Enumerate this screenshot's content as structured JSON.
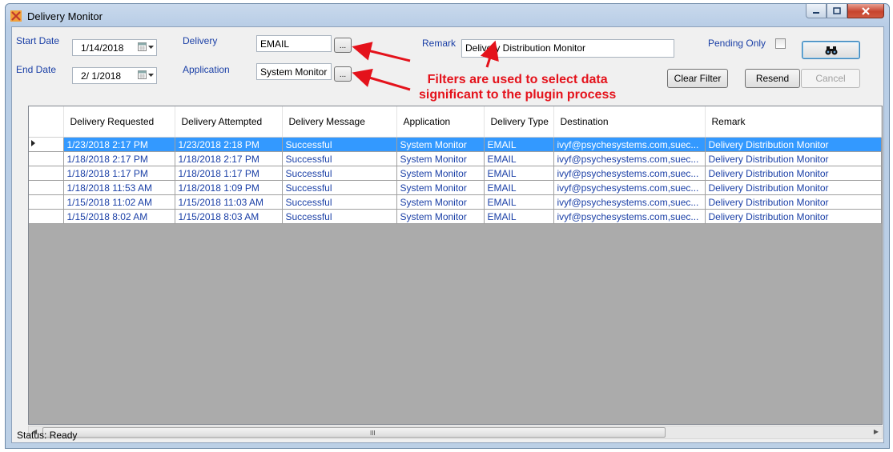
{
  "window": {
    "title": "Delivery Monitor"
  },
  "filters": {
    "start_date_label": "Start Date",
    "start_date_value": "1/14/2018",
    "end_date_label": "End Date",
    "end_date_value": "2/ 1/2018",
    "delivery_label": "Delivery",
    "delivery_value": "EMAIL",
    "application_label": "Application",
    "application_value": "System Monitor",
    "browse_label": "...",
    "remark_label": "Remark",
    "remark_value": "Delivery Distribution Monitor",
    "pending_only_label": "Pending Only",
    "pending_only_checked": false
  },
  "buttons": {
    "clear_filter": "Clear Filter",
    "resend": "Resend",
    "cancel": "Cancel"
  },
  "annotation": {
    "line1": "Filters are used to select data",
    "line2": "significant to the plugin process",
    "color": "#e4121b"
  },
  "grid": {
    "columns": [
      "Delivery Requested",
      "Delivery Attempted",
      "Delivery Message",
      "Application",
      "Delivery Type",
      "Destination",
      "Remark"
    ],
    "rows": [
      [
        "1/23/2018 2:17 PM",
        "1/23/2018 2:18 PM",
        "Successful",
        "System Monitor",
        "EMAIL",
        "ivyf@psychesystems.com,suec...",
        "Delivery Distribution Monitor"
      ],
      [
        "1/18/2018 2:17 PM",
        "1/18/2018 2:17 PM",
        "Successful",
        "System Monitor",
        "EMAIL",
        "ivyf@psychesystems.com,suec...",
        "Delivery Distribution Monitor"
      ],
      [
        "1/18/2018 1:17 PM",
        "1/18/2018 1:17 PM",
        "Successful",
        "System Monitor",
        "EMAIL",
        "ivyf@psychesystems.com,suec...",
        "Delivery Distribution Monitor"
      ],
      [
        "1/18/2018 11:53 AM",
        "1/18/2018 1:09 PM",
        "Successful",
        "System Monitor",
        "EMAIL",
        "ivyf@psychesystems.com,suec...",
        "Delivery Distribution Monitor"
      ],
      [
        "1/15/2018 11:02 AM",
        "1/15/2018 11:03 AM",
        "Successful",
        "System Monitor",
        "EMAIL",
        "ivyf@psychesystems.com,suec...",
        "Delivery Distribution Monitor"
      ],
      [
        "1/15/2018 8:02 AM",
        "1/15/2018 8:03 AM",
        "Successful",
        "System Monitor",
        "EMAIL",
        "ivyf@psychesystems.com,suec...",
        "Delivery Distribution Monitor"
      ]
    ],
    "selected_row": 0,
    "selection_color": "#3399ff",
    "text_color": "#1a3fa6",
    "hscroll_grip": "III"
  },
  "status": {
    "text": "Status: Ready"
  }
}
